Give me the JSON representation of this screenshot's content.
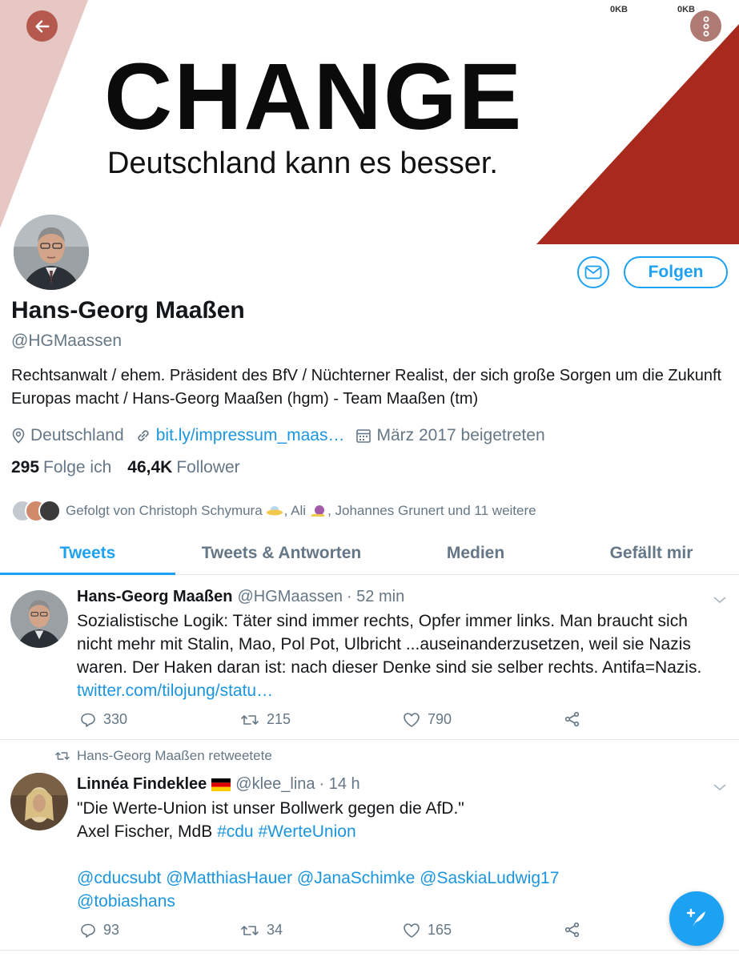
{
  "status_bar": {
    "left_speed": "0KB",
    "right_speed": "0KB"
  },
  "banner": {
    "headline": "CHANGE",
    "subline": "Deutschland kann es besser.",
    "accent_color": "#a82a1e",
    "left_band_color": "#e7c7c4"
  },
  "profile": {
    "name": "Hans-Georg Maaßen",
    "handle": "@HGMaassen",
    "bio": "Rechtsanwalt / ehem. Präsident des BfV / Nüchterner Realist, der sich große Sorgen um die Zukunft Europas macht / Hans-Georg Maaßen (hgm) - Team Maaßen (tm)",
    "location": "Deutschland",
    "link": "bit.ly/impressum_maas…",
    "joined": "März 2017 beigetreten",
    "following_count": "295",
    "following_label": "Folge ich",
    "followers_count": "46,4K",
    "followers_label": "Follower",
    "followed_by_text": "Gefolgt von Christoph Schymura",
    "followed_by_mid": ", Ali",
    "followed_by_end": ", Johannes Grunert und 11 weitere",
    "follow_button": "Folgen"
  },
  "tabs": [
    {
      "label": "Tweets",
      "active": true
    },
    {
      "label": "Tweets & Antworten",
      "active": false
    },
    {
      "label": "Medien",
      "active": false
    },
    {
      "label": "Gefällt mir",
      "active": false
    }
  ],
  "tweets": [
    {
      "author": "Hans-Georg Maaßen",
      "handle": "@HGMaassen",
      "time": "· 52 min",
      "text": "Sozialistische Logik: Täter sind immer rechts, Opfer immer links. Man braucht sich nicht mehr mit Stalin, Mao, Pol Pot, Ulbricht ...auseinanderzusetzen, weil sie Nazis waren. Der Haken daran ist: nach dieser Denke sind sie selber rechts. Antifa=Nazis. ",
      "link": "twitter.com/tilojung/statu…",
      "replies": "330",
      "retweets": "215",
      "likes": "790"
    },
    {
      "retweet_note": "Hans-Georg Maaßen retweetete",
      "author": "Linnéa Findeklee",
      "flag": "🇩🇪",
      "handle": "@klee_lina",
      "time": "· 14 h",
      "line1": "\"Die Werte-Union ist unser Bollwerk gegen die AfD.\"",
      "line2_text": "Axel Fischer, MdB ",
      "tag1": "#cdu",
      "tag2": "#WerteUnion",
      "mentions_line1": "@cducsubt @MatthiasHauer @JanaSchimke @SaskiaLudwig17",
      "mentions_line2": "@tobiashans",
      "replies": "93",
      "retweets": "34",
      "likes": "165"
    }
  ],
  "icons": {
    "back": "arrow-left-icon",
    "more": "more-vertical-icon",
    "message": "envelope-icon",
    "location": "location-pin-icon",
    "link": "link-icon",
    "calendar": "calendar-icon",
    "reply": "reply-icon",
    "retweet": "retweet-icon",
    "like": "heart-icon",
    "share": "share-icon",
    "compose": "compose-tweet-icon"
  }
}
